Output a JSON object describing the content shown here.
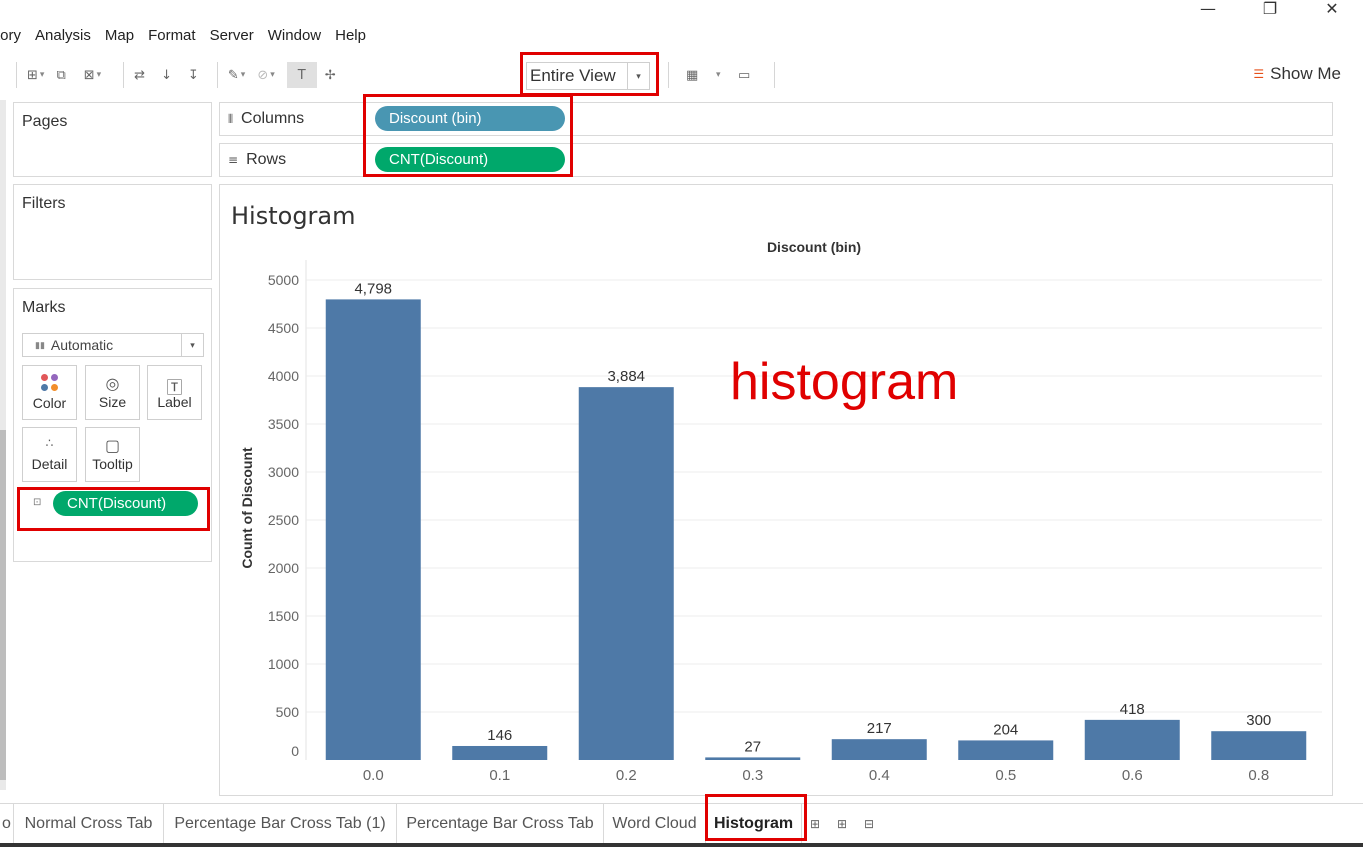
{
  "window": {
    "minimize": "—",
    "restore": "❐",
    "close": "✕"
  },
  "menu": [
    "tory",
    "Analysis",
    "Map",
    "Format",
    "Server",
    "Window",
    "Help"
  ],
  "toolbar": {
    "fit_value": "Entire View",
    "show_me": "Show Me"
  },
  "cards": {
    "pages": "Pages",
    "filters": "Filters",
    "marks": "Marks",
    "mark_type": "Automatic",
    "mark_buttons": [
      "Color",
      "Size",
      "Label",
      "Detail",
      "Tooltip"
    ],
    "mark_pill": "CNT(Discount)"
  },
  "shelves": {
    "columns_label": "Columns",
    "columns_pill": "Discount (bin)",
    "rows_label": "Rows",
    "rows_pill": "CNT(Discount)"
  },
  "view": {
    "title": "Histogram",
    "annotation": "histogram"
  },
  "chart_data": {
    "type": "bar",
    "title": "Histogram",
    "xlabel": "Discount (bin)",
    "ylabel": "Count of Discount",
    "categories": [
      "0.0",
      "0.1",
      "0.2",
      "0.3",
      "0.4",
      "0.5",
      "0.6",
      "0.8"
    ],
    "values": [
      4798,
      146,
      3884,
      27,
      217,
      204,
      418,
      300
    ],
    "data_labels": [
      "4,798",
      "146",
      "3,884",
      "27",
      "217",
      "204",
      "418",
      "300"
    ],
    "yticks": [
      0,
      500,
      1000,
      1500,
      2000,
      2500,
      3000,
      3500,
      4000,
      4500,
      5000
    ],
    "ylim": [
      0,
      5000
    ],
    "grid": true,
    "color": "#4e79a7"
  },
  "tabs": [
    "o",
    "Normal Cross Tab",
    "Percentage Bar Cross Tab (1)",
    "Percentage Bar Cross Tab",
    "Word Cloud",
    "Histogram"
  ],
  "active_tab": "Histogram",
  "colors": {
    "highlight": "#e00000",
    "pill_blue": "#4996b2",
    "pill_green": "#00a86b",
    "bar": "#4e79a7"
  }
}
